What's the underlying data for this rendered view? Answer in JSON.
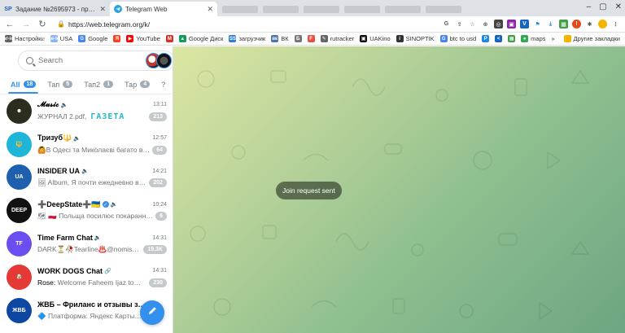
{
  "browser": {
    "tabs": [
      {
        "title": "Задание №2695973 - просмотр з",
        "favicon": "SP",
        "active": false
      },
      {
        "title": "Telegram Web",
        "favicon": "telegram-icon",
        "active": true
      }
    ],
    "url": "https://web.telegram.org/k/",
    "bookmarks": [
      {
        "label": "Настройки",
        "icon": "gear-icon",
        "color": "#5f6368"
      },
      {
        "label": "USA",
        "icon": "page-icon",
        "color": "#8ab4f8"
      },
      {
        "label": "Google",
        "icon": "G",
        "color": "#4285f4"
      },
      {
        "label": "",
        "icon": "Я",
        "color": "#fc3f1d"
      },
      {
        "label": "YouTube",
        "icon": "▶",
        "color": "#ff0000"
      },
      {
        "label": "",
        "icon": "M",
        "color": "#d93025"
      },
      {
        "label": "Google Диск",
        "icon": "▲",
        "color": "#0f9d58"
      },
      {
        "label": "загрузчик",
        "icon": "SS",
        "color": "#2b7fd4"
      },
      {
        "label": "ВК",
        "icon": "вк",
        "color": "#4a76a8"
      },
      {
        "label": "",
        "icon": "Б",
        "color": "#777"
      },
      {
        "label": "",
        "icon": "F",
        "color": "#e5533d"
      },
      {
        "label": "rutracker",
        "icon": "✎",
        "color": "#666"
      },
      {
        "label": "UAKino",
        "icon": "▣",
        "color": "#111"
      },
      {
        "label": "SINOPTIK",
        "icon": "i",
        "color": "#333"
      },
      {
        "label": "btc to usd",
        "icon": "G",
        "color": "#4285f4"
      },
      {
        "label": "",
        "icon": "P",
        "color": "#1e88e5"
      },
      {
        "label": "",
        "icon": "<",
        "color": "#1565c0"
      },
      {
        "label": "",
        "icon": "▦",
        "color": "#43a047"
      },
      {
        "label": "maps",
        "icon": "●",
        "color": "#34a853"
      }
    ],
    "bookmarks_more": "»",
    "other_bookmarks": "Другие закладки"
  },
  "sidebar": {
    "search_placeholder": "Search",
    "folders": [
      {
        "label": "All",
        "badge": "18",
        "active": true
      },
      {
        "label": "Тап",
        "badge": "5",
        "active": false
      },
      {
        "label": "Тап2",
        "badge": "1",
        "active": false
      },
      {
        "label": "Тар",
        "badge": "4",
        "active": false
      },
      {
        "label": "?",
        "badge": "",
        "active": false
      }
    ],
    "chats": [
      {
        "title": "𝓜𝓾𝓼𝓲𝓬",
        "time": "13:11",
        "sender": "",
        "preview": "ЖУРНАЛ 2.pdf,",
        "extra": "ГАЗЕТА",
        "unread": "213",
        "avatar_color": "#2d2d1f",
        "avatar_text": "☻"
      },
      {
        "title": "Тризуб🔱",
        "time": "12:57",
        "sender": "",
        "preview": "🙆В Одесі та Миколаєві багато ви…",
        "extra": "",
        "unread": "64",
        "avatar_color": "#1fb5d8",
        "avatar_text": "🔱"
      },
      {
        "title": "INSIDER UA",
        "time": "14:21",
        "sender": "",
        "preview": "🖼 Album, Я почти ежедневно ви…",
        "extra": "",
        "unread": "202",
        "avatar_color": "#1e5fae",
        "avatar_text": "UA"
      },
      {
        "title": "➕DeepState➕🇺🇦",
        "time": "10:24",
        "sender": "",
        "preview": "🗺 🇵🇱 Польща посилює покаранн…",
        "extra": "",
        "unread": "6",
        "avatar_color": "#111111",
        "avatar_text": "DEEP"
      },
      {
        "title": "Time Farm Chat",
        "time": "14:31",
        "sender": "",
        "preview": "DARK⏳🥀Tearline♨️@nomis…",
        "extra": "",
        "unread": "19.3K",
        "avatar_color": "#6c4df0",
        "avatar_text": "TF"
      },
      {
        "title": "WORK DOGS Chat",
        "time": "14:31",
        "sender": "Rose:",
        "preview": "Welcome Faheem Ijaz to…",
        "extra": "",
        "unread": "230",
        "avatar_color": "#e53935",
        "avatar_text": "🐶"
      },
      {
        "title": "ЖВБ – Фриланс и отзывы з…",
        "time": "",
        "sender": "",
        "preview": "🔷 Платформа: Яндекс Карты…",
        "extra": "",
        "unread": "",
        "avatar_color": "#0d47a1",
        "avatar_text": "ЖВБ"
      }
    ]
  },
  "main": {
    "toast": "Join request sent"
  }
}
